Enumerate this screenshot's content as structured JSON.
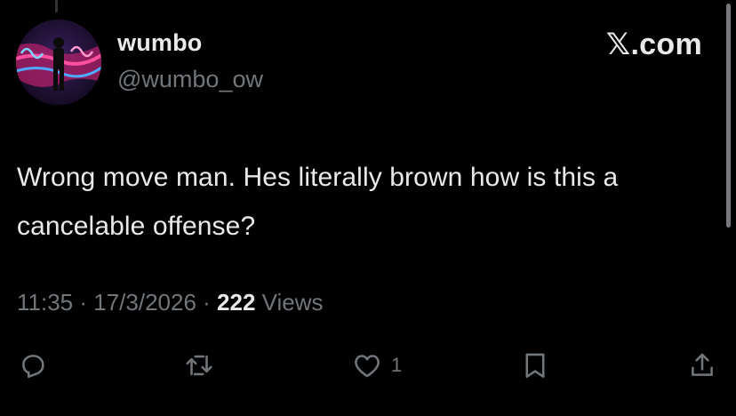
{
  "user": {
    "display_name": "wumbo",
    "handle": "@wumbo_ow"
  },
  "brand": {
    "x_glyph": "𝕏",
    "suffix": ".com"
  },
  "tweet": {
    "text": "Wrong move man. Hes literally brown how is this a cancelable offense?"
  },
  "meta": {
    "time": "11:35",
    "sep1": " · ",
    "date": "17/3/2026",
    "sep2": " · ",
    "views_count": "222",
    "views_label": " Views"
  },
  "actions": {
    "reply_icon": "reply-icon",
    "retweet_icon": "retweet-icon",
    "like_icon": "heart-icon",
    "like_count": "1",
    "bookmark_icon": "bookmark-icon",
    "share_icon": "share-icon"
  },
  "colors": {
    "background": "#000000",
    "text_primary": "#e7e9ea",
    "text_secondary": "#71767b"
  }
}
